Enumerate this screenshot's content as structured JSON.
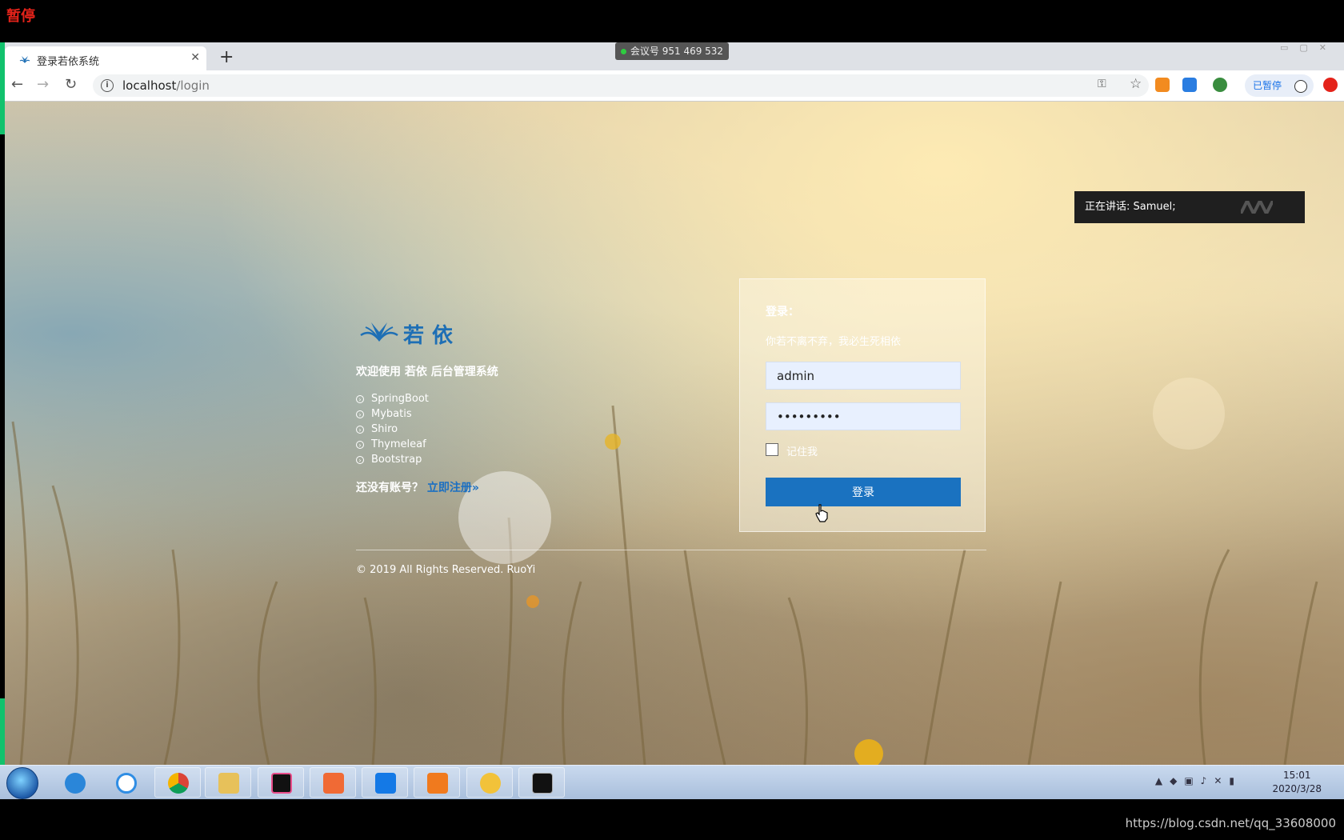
{
  "overlay": {
    "recording_status": "暂停",
    "meeting_id": "会议号 951 469 532",
    "speaker_label": "正在讲话: Samuel;"
  },
  "browser": {
    "tab_title": "登录若依系统",
    "new_tab_symbol": "+",
    "close_symbol": "✕",
    "url_host": "localhost",
    "url_path": "/login",
    "paused_label": "已暂停"
  },
  "page": {
    "logo_text": "若依",
    "welcome": "欢迎使用 若依 后台管理系统",
    "tech_stack": [
      "SpringBoot",
      "Mybatis",
      "Shiro",
      "Thymeleaf",
      "Bootstrap"
    ],
    "no_account": "还没有账号？",
    "register_link": "立即注册»",
    "copyright": "© 2019 All Rights Reserved. RuoYi"
  },
  "login_form": {
    "title": "登录：",
    "subtitle": "你若不离不弃，我必生死相依",
    "username_value": "admin",
    "password_value": "•••••••••",
    "remember_label": "记住我",
    "submit_label": "登录"
  },
  "taskbar": {
    "time": "15:01",
    "date": "2020/3/28"
  },
  "watermark": "https://blog.csdn.net/qq_33608000",
  "colors": {
    "primary": "#1a72c0",
    "input_bg": "#e8f0fe",
    "paused_red": "#e4231a"
  }
}
